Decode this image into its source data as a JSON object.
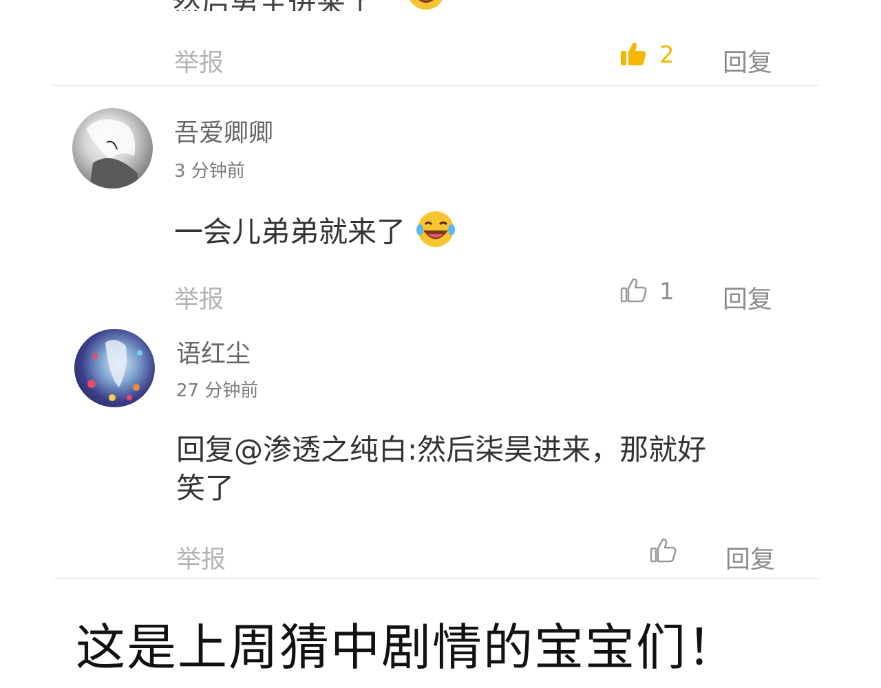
{
  "top_comment": {
    "text_partial": "然后男主进来了",
    "report_label": "举报",
    "like_count": "2",
    "reply_label": "回复"
  },
  "comments": [
    {
      "username": "吾爱卿卿",
      "time": "3 分钟前",
      "text": "一会儿弟弟就来了",
      "emoji": "laughing-crying-emoji",
      "report_label": "举报",
      "like_count": "1",
      "reply_label": "回复"
    },
    {
      "username": "语红尘",
      "time": "27 分钟前",
      "text_line1": "回复@渗透之纯白:然后柒昊进来，那就好",
      "text_line2": "笑了",
      "report_label": "举报",
      "like_count": "",
      "reply_label": "回复"
    }
  ],
  "footer": {
    "caption": "这是上周猜中剧情的宝宝们！"
  },
  "colors": {
    "like_active": "#f5b800",
    "muted_text": "#b3b3b3",
    "divider": "#efefef"
  }
}
